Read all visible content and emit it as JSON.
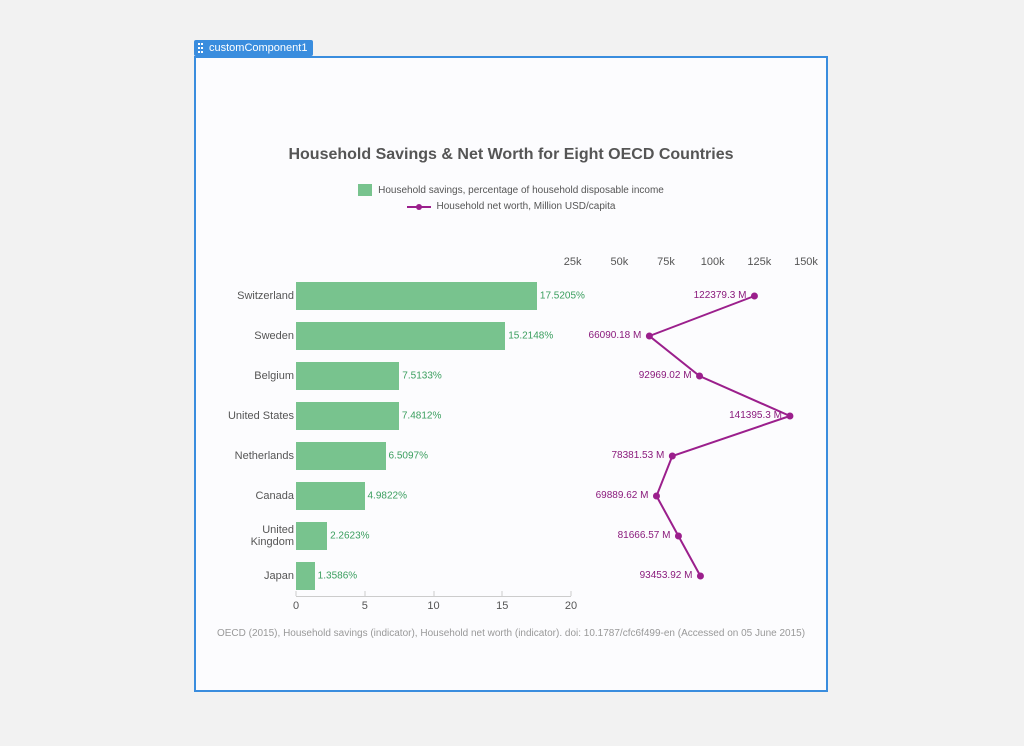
{
  "component_tag": "customComponent1",
  "title": "Household Savings & Net Worth for Eight OECD Countries",
  "legend": {
    "bar": "Household savings, percentage of household disposable income",
    "line": "Household net worth, Million USD/capita"
  },
  "caption": "OECD (2015), Household savings (indicator), Household net worth (indicator). doi: 10.1787/cfc6f499-en (Accessed on 05 June 2015)",
  "bar_axis": {
    "ticks": [
      0,
      5,
      10,
      15,
      20
    ]
  },
  "top_axis": {
    "ticks": [
      25000,
      50000,
      75000,
      100000,
      125000,
      150000
    ],
    "tick_labels": [
      "25k",
      "50k",
      "75k",
      "100k",
      "125k",
      "150k"
    ]
  },
  "rows": [
    {
      "country": "Switzerland",
      "savings": 17.5205,
      "networth": 122379.3,
      "networth_label": "122379.3 M"
    },
    {
      "country": "Sweden",
      "savings": 15.2148,
      "networth": 66090.18,
      "networth_label": "66090.18 M"
    },
    {
      "country": "Belgium",
      "savings": 7.5133,
      "networth": 92969.02,
      "networth_label": "92969.02 M"
    },
    {
      "country": "United States",
      "savings": 7.4812,
      "networth": 141395.3,
      "networth_label": "141395.3 M"
    },
    {
      "country": "Netherlands",
      "savings": 6.5097,
      "networth": 78381.53,
      "networth_label": "78381.53 M"
    },
    {
      "country": "Canada",
      "savings": 4.9822,
      "networth": 69889.62,
      "networth_label": "69889.62 M"
    },
    {
      "country": "United Kingdom",
      "savings": 2.2623,
      "networth": 81666.57,
      "networth_label": "81666.57 M"
    },
    {
      "country": "Japan",
      "savings": 1.3586,
      "networth": 93453.92,
      "networth_label": "93453.92 M"
    }
  ],
  "chart_data": {
    "type": "bar",
    "title": "Household Savings & Net Worth for Eight OECD Countries",
    "orientation": "horizontal",
    "categories": [
      "Switzerland",
      "Sweden",
      "Belgium",
      "United States",
      "Netherlands",
      "Canada",
      "United Kingdom",
      "Japan"
    ],
    "series": [
      {
        "name": "Household savings, percentage of household disposable income",
        "axis": "x1",
        "type": "bar",
        "values": [
          17.5205,
          15.2148,
          7.5133,
          7.4812,
          6.5097,
          4.9822,
          2.2623,
          1.3586
        ]
      },
      {
        "name": "Household net worth, Million USD/capita",
        "axis": "x2",
        "type": "line",
        "values": [
          122379.3,
          66090.18,
          92969.02,
          141395.3,
          78381.53,
          69889.62,
          81666.57,
          93453.92
        ]
      }
    ],
    "x1": {
      "label": "",
      "lim": [
        0,
        20
      ],
      "ticks": [
        0,
        5,
        10,
        15,
        20
      ]
    },
    "x2": {
      "label": "",
      "lim": [
        0,
        150000
      ],
      "ticks": [
        25000,
        50000,
        75000,
        100000,
        125000,
        150000
      ]
    },
    "source": "OECD (2015), Household savings (indicator), Household net worth (indicator). doi: 10.1787/cfc6f499-en (Accessed on 05 June 2015)"
  }
}
